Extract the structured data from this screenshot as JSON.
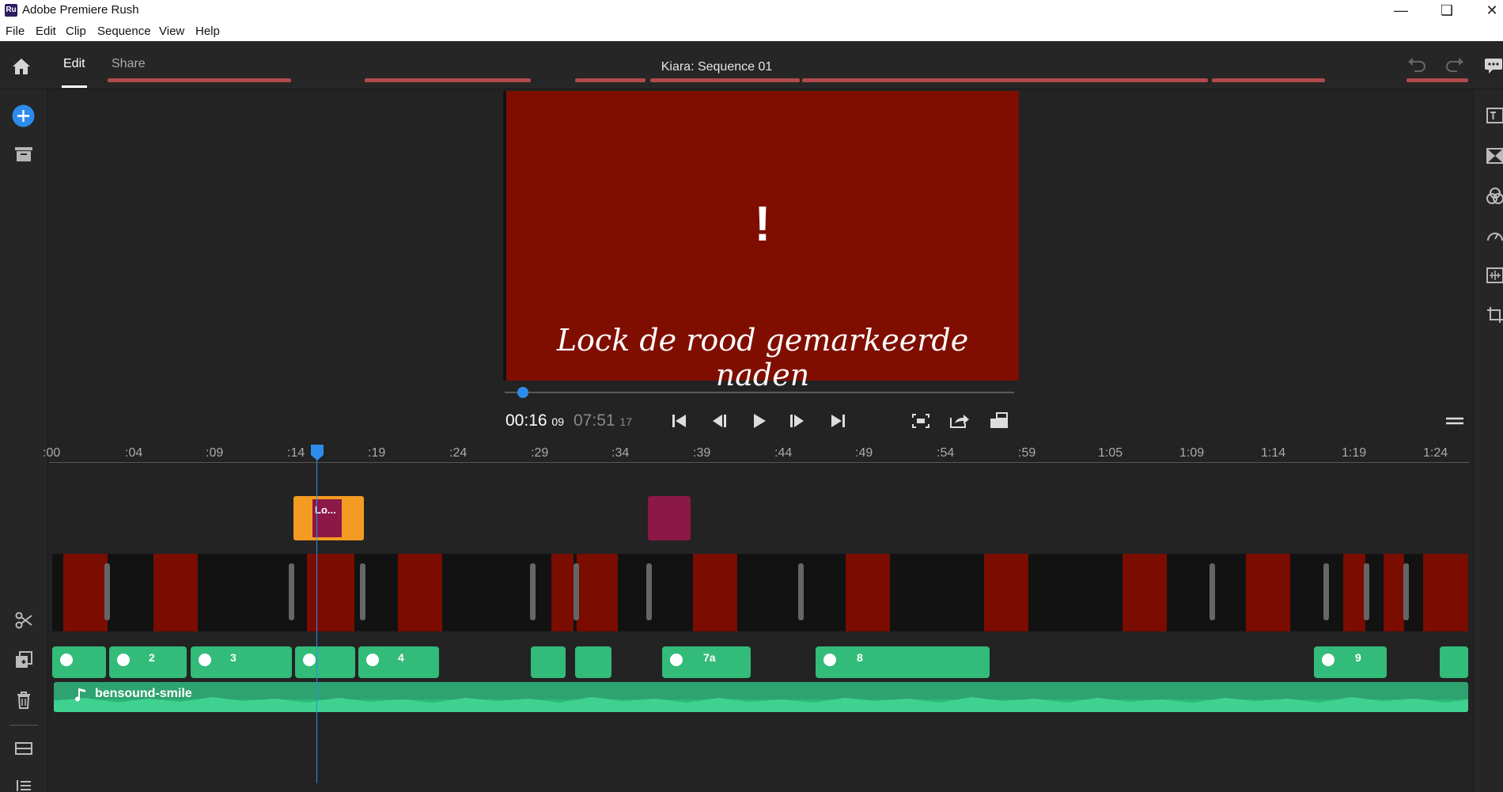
{
  "window": {
    "title": "Adobe Premiere Rush",
    "logo_text": "Ru"
  },
  "menu": [
    "File",
    "Edit",
    "Clip",
    "Sequence",
    "View",
    "Help"
  ],
  "header": {
    "tabs": [
      {
        "label": "Edit",
        "active": true
      },
      {
        "label": "Share",
        "active": false
      }
    ],
    "sequence_title": "Kiara: Sequence 01"
  },
  "preview": {
    "caption": "Lock de rood gemarkeerde naden",
    "symbol": "!",
    "background": "#7f0e00",
    "scrub_progress": 0.035
  },
  "timecode": {
    "current_main": "00:16",
    "current_frames": "09",
    "total_main": "07:51",
    "total_frames": "17"
  },
  "ruler": {
    "labels": [
      ":00",
      ":04",
      ":09",
      ":14",
      ":19",
      ":24",
      ":29",
      ":34",
      ":39",
      ":44",
      ":49",
      ":54",
      ":59",
      "1:05",
      "1:09",
      "1:14",
      "1:19",
      "1:24"
    ]
  },
  "title_clips": [
    {
      "label": "Lo...",
      "selected": true
    },
    {
      "label": "",
      "selected": false
    }
  ],
  "audio_clips": [
    "",
    "2",
    "3",
    "",
    "4",
    "",
    "",
    "7a",
    "8",
    "9",
    ""
  ],
  "music": {
    "name": "bensound-smile"
  },
  "colors": {
    "accent": "#2d8ceb",
    "title_clip": "#8b1846",
    "title_selected": "#f39b22",
    "audio": "#33bb7a"
  }
}
